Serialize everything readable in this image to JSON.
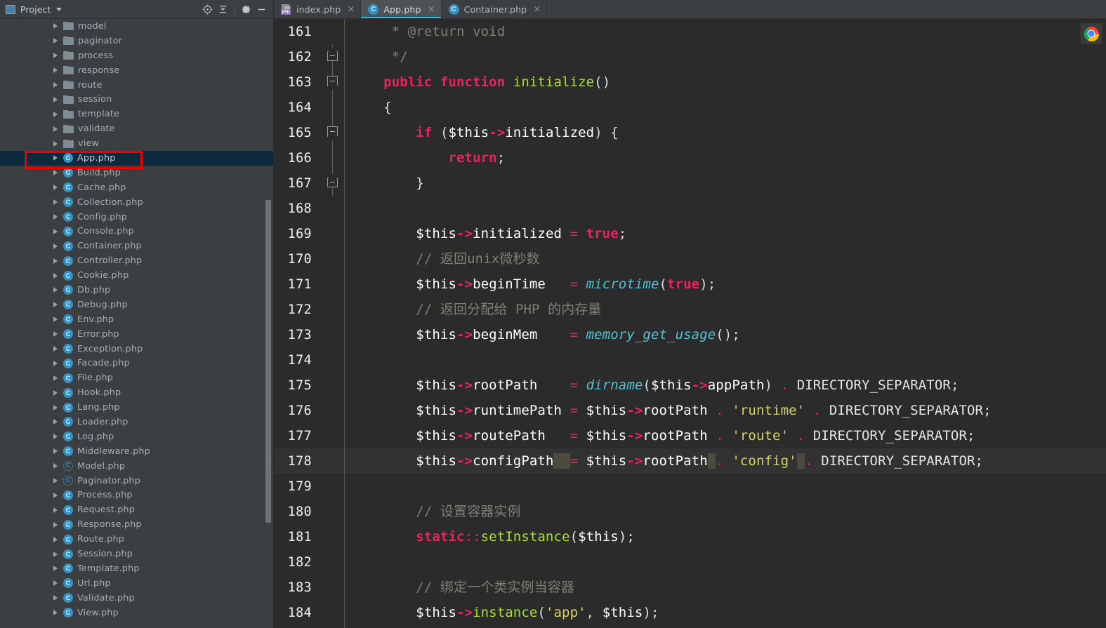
{
  "sidebar": {
    "title": "Project",
    "title_icon": "project-panel-icon",
    "caret_icon": "chevron-down-icon",
    "toolbar": [
      {
        "name": "locate-icon",
        "glyph": "target"
      },
      {
        "name": "collapse-all-icon",
        "glyph": "collapse"
      },
      {
        "name": "settings-gear-icon",
        "glyph": "gear"
      },
      {
        "name": "hide-panel-icon",
        "glyph": "minus"
      }
    ],
    "annotation": {
      "name": "red-highlight-box",
      "color": "#ef0000",
      "target": "App.php"
    },
    "items": [
      {
        "label": "model",
        "icon": "folder-icon",
        "type": "folder"
      },
      {
        "label": "paginator",
        "icon": "folder-icon",
        "type": "folder"
      },
      {
        "label": "process",
        "icon": "folder-icon",
        "type": "folder"
      },
      {
        "label": "response",
        "icon": "folder-icon",
        "type": "folder"
      },
      {
        "label": "route",
        "icon": "folder-icon",
        "type": "folder"
      },
      {
        "label": "session",
        "icon": "folder-icon",
        "type": "folder"
      },
      {
        "label": "template",
        "icon": "folder-icon",
        "type": "folder"
      },
      {
        "label": "validate",
        "icon": "folder-icon",
        "type": "folder"
      },
      {
        "label": "view",
        "icon": "folder-icon",
        "type": "folder"
      },
      {
        "label": "App.php",
        "icon": "php-class-icon",
        "type": "class",
        "selected": true
      },
      {
        "label": "Build.php",
        "icon": "php-class-icon",
        "type": "class"
      },
      {
        "label": "Cache.php",
        "icon": "php-class-icon",
        "type": "class"
      },
      {
        "label": "Collection.php",
        "icon": "php-class-icon",
        "type": "class"
      },
      {
        "label": "Config.php",
        "icon": "php-class-icon",
        "type": "class"
      },
      {
        "label": "Console.php",
        "icon": "php-class-icon",
        "type": "class"
      },
      {
        "label": "Container.php",
        "icon": "php-class-icon",
        "type": "class"
      },
      {
        "label": "Controller.php",
        "icon": "php-class-icon",
        "type": "class"
      },
      {
        "label": "Cookie.php",
        "icon": "php-class-icon",
        "type": "class"
      },
      {
        "label": "Db.php",
        "icon": "php-class-icon",
        "type": "class"
      },
      {
        "label": "Debug.php",
        "icon": "php-class-icon",
        "type": "class"
      },
      {
        "label": "Env.php",
        "icon": "php-class-icon",
        "type": "class"
      },
      {
        "label": "Error.php",
        "icon": "php-class-icon",
        "type": "class"
      },
      {
        "label": "Exception.php",
        "icon": "php-class-icon",
        "type": "class"
      },
      {
        "label": "Facade.php",
        "icon": "php-class-icon",
        "type": "class"
      },
      {
        "label": "File.php",
        "icon": "php-class-icon",
        "type": "class"
      },
      {
        "label": "Hook.php",
        "icon": "php-class-icon",
        "type": "class"
      },
      {
        "label": "Lang.php",
        "icon": "php-class-icon",
        "type": "class"
      },
      {
        "label": "Loader.php",
        "icon": "php-class-icon",
        "type": "class"
      },
      {
        "label": "Log.php",
        "icon": "php-class-icon",
        "type": "class"
      },
      {
        "label": "Middleware.php",
        "icon": "php-class-icon",
        "type": "class"
      },
      {
        "label": "Model.php",
        "icon": "php-abstract-class-icon",
        "type": "abstract"
      },
      {
        "label": "Paginator.php",
        "icon": "php-abstract-class-icon",
        "type": "abstract"
      },
      {
        "label": "Process.php",
        "icon": "php-class-icon",
        "type": "class"
      },
      {
        "label": "Request.php",
        "icon": "php-class-icon",
        "type": "class"
      },
      {
        "label": "Response.php",
        "icon": "php-class-icon",
        "type": "class"
      },
      {
        "label": "Route.php",
        "icon": "php-class-icon",
        "type": "class"
      },
      {
        "label": "Session.php",
        "icon": "php-class-icon",
        "type": "class"
      },
      {
        "label": "Template.php",
        "icon": "php-class-icon",
        "type": "class"
      },
      {
        "label": "Url.php",
        "icon": "php-class-icon",
        "type": "class"
      },
      {
        "label": "Validate.php",
        "icon": "php-class-icon",
        "type": "class"
      },
      {
        "label": "View.php",
        "icon": "php-class-icon",
        "type": "class"
      }
    ]
  },
  "tabs": [
    {
      "label": "index.php",
      "icon": "php-file-icon",
      "active": false,
      "close": "×"
    },
    {
      "label": "App.php",
      "icon": "php-class-icon",
      "active": true,
      "close": "×"
    },
    {
      "label": "Container.php",
      "icon": "php-class-icon",
      "active": false,
      "close": "×"
    }
  ],
  "editor": {
    "current_line": 178,
    "first_line": 161,
    "last_line": 184,
    "chrome_button": "chrome-browser-icon",
    "lines": [
      {
        "n": "161",
        "fold": "none",
        "segments": [
          {
            "t": "cmt",
            "s": "     * @return void"
          }
        ]
      },
      {
        "n": "162",
        "fold": "end",
        "segments": [
          {
            "t": "cmt",
            "s": "     */"
          }
        ]
      },
      {
        "n": "163",
        "fold": "start",
        "segments": [
          {
            "t": "kw",
            "s": "    public function "
          },
          {
            "t": "fn",
            "s": "initialize"
          },
          {
            "t": "punc",
            "s": "()"
          }
        ]
      },
      {
        "n": "164",
        "fold": "none",
        "segments": [
          {
            "t": "punc",
            "s": "    {"
          }
        ]
      },
      {
        "n": "165",
        "fold": "start",
        "segments": [
          {
            "t": "kw",
            "s": "        if "
          },
          {
            "t": "punc",
            "s": "("
          },
          {
            "t": "var",
            "s": "$this"
          },
          {
            "t": "arrow",
            "s": "->"
          },
          {
            "t": "var",
            "s": "initialized"
          },
          {
            "t": "punc",
            "s": ") {"
          }
        ]
      },
      {
        "n": "166",
        "fold": "none",
        "segments": [
          {
            "t": "kw",
            "s": "            return"
          },
          {
            "t": "punc",
            "s": ";"
          }
        ]
      },
      {
        "n": "167",
        "fold": "end",
        "segments": [
          {
            "t": "punc",
            "s": "        }"
          }
        ]
      },
      {
        "n": "168",
        "fold": "none",
        "segments": [
          {
            "t": "punc",
            "s": ""
          }
        ]
      },
      {
        "n": "169",
        "fold": "none",
        "segments": [
          {
            "t": "var",
            "s": "        $this"
          },
          {
            "t": "arrow",
            "s": "->"
          },
          {
            "t": "var",
            "s": "initialized "
          },
          {
            "t": "op",
            "s": "= "
          },
          {
            "t": "kw",
            "s": "true"
          },
          {
            "t": "punc",
            "s": ";"
          }
        ]
      },
      {
        "n": "170",
        "fold": "none",
        "segments": [
          {
            "t": "cmt",
            "s": "        // 返回unix微秒数"
          }
        ]
      },
      {
        "n": "171",
        "fold": "none",
        "segments": [
          {
            "t": "var",
            "s": "        $this"
          },
          {
            "t": "arrow",
            "s": "->"
          },
          {
            "t": "var",
            "s": "beginTime   "
          },
          {
            "t": "op",
            "s": "= "
          },
          {
            "t": "bif",
            "s": "microtime"
          },
          {
            "t": "punc",
            "s": "("
          },
          {
            "t": "kw",
            "s": "true"
          },
          {
            "t": "punc",
            "s": ");"
          }
        ]
      },
      {
        "n": "172",
        "fold": "none",
        "segments": [
          {
            "t": "cmt",
            "s": "        // 返回分配给 PHP 的内存量"
          }
        ]
      },
      {
        "n": "173",
        "fold": "none",
        "segments": [
          {
            "t": "var",
            "s": "        $this"
          },
          {
            "t": "arrow",
            "s": "->"
          },
          {
            "t": "var",
            "s": "beginMem    "
          },
          {
            "t": "op",
            "s": "= "
          },
          {
            "t": "bif",
            "s": "memory_get_usage"
          },
          {
            "t": "punc",
            "s": "();"
          }
        ]
      },
      {
        "n": "174",
        "fold": "none",
        "segments": [
          {
            "t": "punc",
            "s": ""
          }
        ]
      },
      {
        "n": "175",
        "fold": "none",
        "segments": [
          {
            "t": "var",
            "s": "        $this"
          },
          {
            "t": "arrow",
            "s": "->"
          },
          {
            "t": "var",
            "s": "rootPath    "
          },
          {
            "t": "op",
            "s": "= "
          },
          {
            "t": "bif",
            "s": "dirname"
          },
          {
            "t": "punc",
            "s": "("
          },
          {
            "t": "var",
            "s": "$this"
          },
          {
            "t": "arrow",
            "s": "->"
          },
          {
            "t": "var",
            "s": "appPath"
          },
          {
            "t": "punc",
            "s": ") "
          },
          {
            "t": "dot",
            "s": ". "
          },
          {
            "t": "const",
            "s": "DIRECTORY_SEPARATOR"
          },
          {
            "t": "punc",
            "s": ";"
          }
        ]
      },
      {
        "n": "176",
        "fold": "none",
        "segments": [
          {
            "t": "var",
            "s": "        $this"
          },
          {
            "t": "arrow",
            "s": "->"
          },
          {
            "t": "var",
            "s": "runtimePath "
          },
          {
            "t": "op",
            "s": "= "
          },
          {
            "t": "var",
            "s": "$this"
          },
          {
            "t": "arrow",
            "s": "->"
          },
          {
            "t": "var",
            "s": "rootPath "
          },
          {
            "t": "dot",
            "s": ". "
          },
          {
            "t": "str",
            "s": "'runtime' "
          },
          {
            "t": "dot",
            "s": ". "
          },
          {
            "t": "const",
            "s": "DIRECTORY_SEPARATOR"
          },
          {
            "t": "punc",
            "s": ";"
          }
        ]
      },
      {
        "n": "177",
        "fold": "none",
        "segments": [
          {
            "t": "var",
            "s": "        $this"
          },
          {
            "t": "arrow",
            "s": "->"
          },
          {
            "t": "var",
            "s": "routePath   "
          },
          {
            "t": "op",
            "s": "= "
          },
          {
            "t": "var",
            "s": "$this"
          },
          {
            "t": "arrow",
            "s": "->"
          },
          {
            "t": "var",
            "s": "rootPath "
          },
          {
            "t": "dot",
            "s": ". "
          },
          {
            "t": "str",
            "s": "'route' "
          },
          {
            "t": "dot",
            "s": ". "
          },
          {
            "t": "const",
            "s": "DIRECTORY_SEPARATOR"
          },
          {
            "t": "punc",
            "s": ";"
          }
        ]
      },
      {
        "n": "178",
        "fold": "none",
        "current": true,
        "segments": [
          {
            "t": "var",
            "s": "        $this"
          },
          {
            "t": "arrow",
            "s": "->"
          },
          {
            "t": "var",
            "s": "configPath"
          },
          {
            "t": "ws",
            "s": "  "
          },
          {
            "t": "op",
            "s": "= "
          },
          {
            "t": "var",
            "s": "$this"
          },
          {
            "t": "arrow",
            "s": "->"
          },
          {
            "t": "var",
            "s": "rootPath"
          },
          {
            "t": "ws",
            "s": " "
          },
          {
            "t": "dot",
            "s": ". "
          },
          {
            "t": "str",
            "s": "'config'"
          },
          {
            "t": "ws",
            "s": " "
          },
          {
            "t": "dot",
            "s": ". "
          },
          {
            "t": "const",
            "s": "DIRECTORY_SEPARATOR"
          },
          {
            "t": "punc",
            "s": ";"
          }
        ]
      },
      {
        "n": "179",
        "fold": "none",
        "segments": [
          {
            "t": "punc",
            "s": ""
          }
        ]
      },
      {
        "n": "180",
        "fold": "none",
        "segments": [
          {
            "t": "cmt",
            "s": "        // 设置容器实例"
          }
        ]
      },
      {
        "n": "181",
        "fold": "none",
        "segments": [
          {
            "t": "kw",
            "s": "        static"
          },
          {
            "t": "op",
            "s": "::"
          },
          {
            "t": "fn",
            "s": "setInstance"
          },
          {
            "t": "punc",
            "s": "("
          },
          {
            "t": "var",
            "s": "$this"
          },
          {
            "t": "punc",
            "s": ");"
          }
        ]
      },
      {
        "n": "182",
        "fold": "none",
        "segments": [
          {
            "t": "punc",
            "s": ""
          }
        ]
      },
      {
        "n": "183",
        "fold": "none",
        "segments": [
          {
            "t": "cmt",
            "s": "        // 绑定一个类实例当容器"
          }
        ]
      },
      {
        "n": "184",
        "fold": "none",
        "segments": [
          {
            "t": "var",
            "s": "        $this"
          },
          {
            "t": "arrow",
            "s": "->"
          },
          {
            "t": "fn",
            "s": "instance"
          },
          {
            "t": "punc",
            "s": "("
          },
          {
            "t": "str",
            "s": "'app'"
          },
          {
            "t": "punc",
            "s": ", "
          },
          {
            "t": "var",
            "s": "$this"
          },
          {
            "t": "punc",
            "s": ");"
          }
        ]
      }
    ]
  },
  "colors": {
    "sidebar_bg": "#3c3f41",
    "editor_bg": "#2b2b2b",
    "selection_bg": "#0d293e",
    "current_line_bg": "#323232",
    "accent_tab_underline": "#35b1d8",
    "keyword": "#e8245f",
    "function": "#a6e22e",
    "comment": "#7f7f74",
    "string": "#d8d264",
    "builtin": "#4fc4d6",
    "annotation_red": "#ef0000"
  }
}
